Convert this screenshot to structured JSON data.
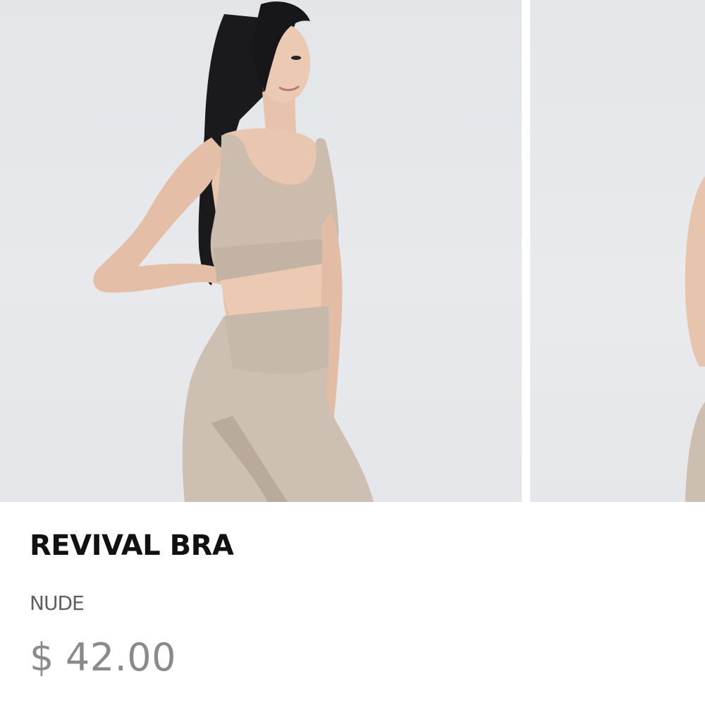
{
  "gallery": {
    "slides": [
      {
        "alt": "product-photo-main"
      },
      {
        "alt": "product-photo-next"
      }
    ]
  },
  "product": {
    "title": "REVIVAL BRA",
    "color": "NUDE",
    "price": {
      "currency": "$",
      "amount": "42.00"
    }
  },
  "colors": {
    "background": "#e5e8eb",
    "garment": "#cbbcae",
    "title": "#111111",
    "price": "#8a8a8a"
  }
}
